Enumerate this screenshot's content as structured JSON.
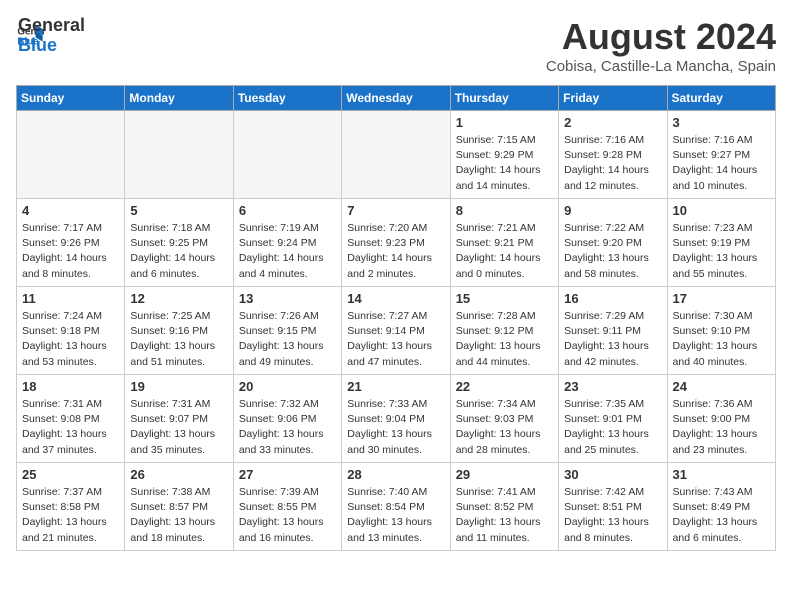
{
  "header": {
    "logo_general": "General",
    "logo_blue": "Blue",
    "month_title": "August 2024",
    "subtitle": "Cobisa, Castille-La Mancha, Spain"
  },
  "weekdays": [
    "Sunday",
    "Monday",
    "Tuesday",
    "Wednesday",
    "Thursday",
    "Friday",
    "Saturday"
  ],
  "weeks": [
    [
      {
        "day": "",
        "info": ""
      },
      {
        "day": "",
        "info": ""
      },
      {
        "day": "",
        "info": ""
      },
      {
        "day": "",
        "info": ""
      },
      {
        "day": "1",
        "info": "Sunrise: 7:15 AM\nSunset: 9:29 PM\nDaylight: 14 hours\nand 14 minutes."
      },
      {
        "day": "2",
        "info": "Sunrise: 7:16 AM\nSunset: 9:28 PM\nDaylight: 14 hours\nand 12 minutes."
      },
      {
        "day": "3",
        "info": "Sunrise: 7:16 AM\nSunset: 9:27 PM\nDaylight: 14 hours\nand 10 minutes."
      }
    ],
    [
      {
        "day": "4",
        "info": "Sunrise: 7:17 AM\nSunset: 9:26 PM\nDaylight: 14 hours\nand 8 minutes."
      },
      {
        "day": "5",
        "info": "Sunrise: 7:18 AM\nSunset: 9:25 PM\nDaylight: 14 hours\nand 6 minutes."
      },
      {
        "day": "6",
        "info": "Sunrise: 7:19 AM\nSunset: 9:24 PM\nDaylight: 14 hours\nand 4 minutes."
      },
      {
        "day": "7",
        "info": "Sunrise: 7:20 AM\nSunset: 9:23 PM\nDaylight: 14 hours\nand 2 minutes."
      },
      {
        "day": "8",
        "info": "Sunrise: 7:21 AM\nSunset: 9:21 PM\nDaylight: 14 hours\nand 0 minutes."
      },
      {
        "day": "9",
        "info": "Sunrise: 7:22 AM\nSunset: 9:20 PM\nDaylight: 13 hours\nand 58 minutes."
      },
      {
        "day": "10",
        "info": "Sunrise: 7:23 AM\nSunset: 9:19 PM\nDaylight: 13 hours\nand 55 minutes."
      }
    ],
    [
      {
        "day": "11",
        "info": "Sunrise: 7:24 AM\nSunset: 9:18 PM\nDaylight: 13 hours\nand 53 minutes."
      },
      {
        "day": "12",
        "info": "Sunrise: 7:25 AM\nSunset: 9:16 PM\nDaylight: 13 hours\nand 51 minutes."
      },
      {
        "day": "13",
        "info": "Sunrise: 7:26 AM\nSunset: 9:15 PM\nDaylight: 13 hours\nand 49 minutes."
      },
      {
        "day": "14",
        "info": "Sunrise: 7:27 AM\nSunset: 9:14 PM\nDaylight: 13 hours\nand 47 minutes."
      },
      {
        "day": "15",
        "info": "Sunrise: 7:28 AM\nSunset: 9:12 PM\nDaylight: 13 hours\nand 44 minutes."
      },
      {
        "day": "16",
        "info": "Sunrise: 7:29 AM\nSunset: 9:11 PM\nDaylight: 13 hours\nand 42 minutes."
      },
      {
        "day": "17",
        "info": "Sunrise: 7:30 AM\nSunset: 9:10 PM\nDaylight: 13 hours\nand 40 minutes."
      }
    ],
    [
      {
        "day": "18",
        "info": "Sunrise: 7:31 AM\nSunset: 9:08 PM\nDaylight: 13 hours\nand 37 minutes."
      },
      {
        "day": "19",
        "info": "Sunrise: 7:31 AM\nSunset: 9:07 PM\nDaylight: 13 hours\nand 35 minutes."
      },
      {
        "day": "20",
        "info": "Sunrise: 7:32 AM\nSunset: 9:06 PM\nDaylight: 13 hours\nand 33 minutes."
      },
      {
        "day": "21",
        "info": "Sunrise: 7:33 AM\nSunset: 9:04 PM\nDaylight: 13 hours\nand 30 minutes."
      },
      {
        "day": "22",
        "info": "Sunrise: 7:34 AM\nSunset: 9:03 PM\nDaylight: 13 hours\nand 28 minutes."
      },
      {
        "day": "23",
        "info": "Sunrise: 7:35 AM\nSunset: 9:01 PM\nDaylight: 13 hours\nand 25 minutes."
      },
      {
        "day": "24",
        "info": "Sunrise: 7:36 AM\nSunset: 9:00 PM\nDaylight: 13 hours\nand 23 minutes."
      }
    ],
    [
      {
        "day": "25",
        "info": "Sunrise: 7:37 AM\nSunset: 8:58 PM\nDaylight: 13 hours\nand 21 minutes."
      },
      {
        "day": "26",
        "info": "Sunrise: 7:38 AM\nSunset: 8:57 PM\nDaylight: 13 hours\nand 18 minutes."
      },
      {
        "day": "27",
        "info": "Sunrise: 7:39 AM\nSunset: 8:55 PM\nDaylight: 13 hours\nand 16 minutes."
      },
      {
        "day": "28",
        "info": "Sunrise: 7:40 AM\nSunset: 8:54 PM\nDaylight: 13 hours\nand 13 minutes."
      },
      {
        "day": "29",
        "info": "Sunrise: 7:41 AM\nSunset: 8:52 PM\nDaylight: 13 hours\nand 11 minutes."
      },
      {
        "day": "30",
        "info": "Sunrise: 7:42 AM\nSunset: 8:51 PM\nDaylight: 13 hours\nand 8 minutes."
      },
      {
        "day": "31",
        "info": "Sunrise: 7:43 AM\nSunset: 8:49 PM\nDaylight: 13 hours\nand 6 minutes."
      }
    ]
  ]
}
